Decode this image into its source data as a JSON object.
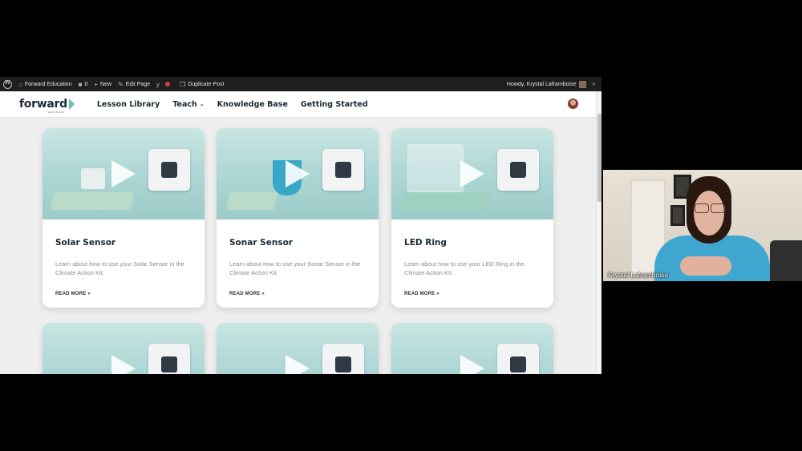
{
  "admin_bar": {
    "site_name": "Forward Education",
    "comments_count": "0",
    "new_label": "New",
    "edit_page_label": "Edit Page",
    "duplicate_post_label": "Duplicate Post",
    "howdy_label": "Howdy, Krystal Laframboise"
  },
  "header": {
    "logo_text": "forward",
    "logo_subtext": "EDUCATION",
    "nav": [
      {
        "label": "Lesson Library"
      },
      {
        "label": "Teach"
      },
      {
        "label": "Knowledge Base"
      },
      {
        "label": "Getting Started"
      }
    ]
  },
  "cards": [
    {
      "title": "Solar Sensor",
      "description": "Learn about how to use your Solar Sensor in the Climate Action Kit.",
      "read_more": "READ MORE »"
    },
    {
      "title": "Sonar Sensor",
      "description": "Learn about how to use your Sonar Sensor in the Climate Action Kit.",
      "read_more": "READ MORE »"
    },
    {
      "title": "LED Ring",
      "description": "Learn about how to use your LED Ring in the Climate Action Kit.",
      "read_more": "READ MORE »"
    }
  ],
  "video_call": {
    "participant_name": "Krystal Laframboise"
  },
  "icons": {
    "wordpress": "wordpress-logo-icon",
    "site": "dashboard-icon",
    "comments": "comment-bubble-icon",
    "new": "plus-icon",
    "edit": "pencil-icon",
    "yoast": "yoast-seo-icon",
    "duplicate": "duplicate-icon",
    "search": "search-icon",
    "play": "play-icon"
  },
  "colors": {
    "admin_bar_bg": "#1e1e1e",
    "brand_dark": "#1b2a36",
    "brand_accent": "#5fc4a8",
    "thumb_teal": "#a9d4d2",
    "record_dot": "#e23b3b"
  }
}
